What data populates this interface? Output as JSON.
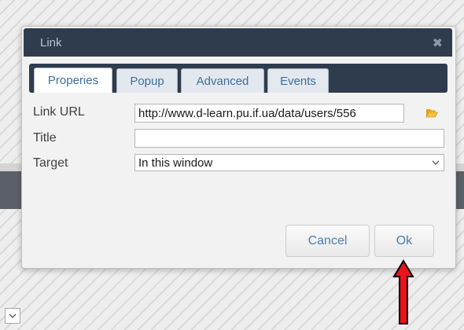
{
  "dialog": {
    "title": "Link",
    "close_glyph": "✖",
    "tabs": [
      {
        "label": "Properies",
        "active": true
      },
      {
        "label": "Popup",
        "active": false
      },
      {
        "label": "Advanced",
        "active": false
      },
      {
        "label": "Events",
        "active": false
      }
    ],
    "form": {
      "link_url_label": "Link URL",
      "link_url_value": "http://www.d-learn.pu.if.ua/data/users/556",
      "title_label": "Title",
      "title_value": "",
      "target_label": "Target",
      "target_value": "In this window"
    },
    "buttons": {
      "cancel": "Cancel",
      "ok": "Ok"
    }
  },
  "icons": {
    "close": "close-icon",
    "browse": "folder-open-icon",
    "dropdown": "chevron-down-icon",
    "annotation": "red-arrow-up-icon"
  },
  "colors": {
    "titlebar": "#2e3c4e",
    "tab_text": "#3d6f9e",
    "button_text": "#4d7fae",
    "annotation_arrow": "#e8141b",
    "folder_icon": "#f0a818"
  }
}
